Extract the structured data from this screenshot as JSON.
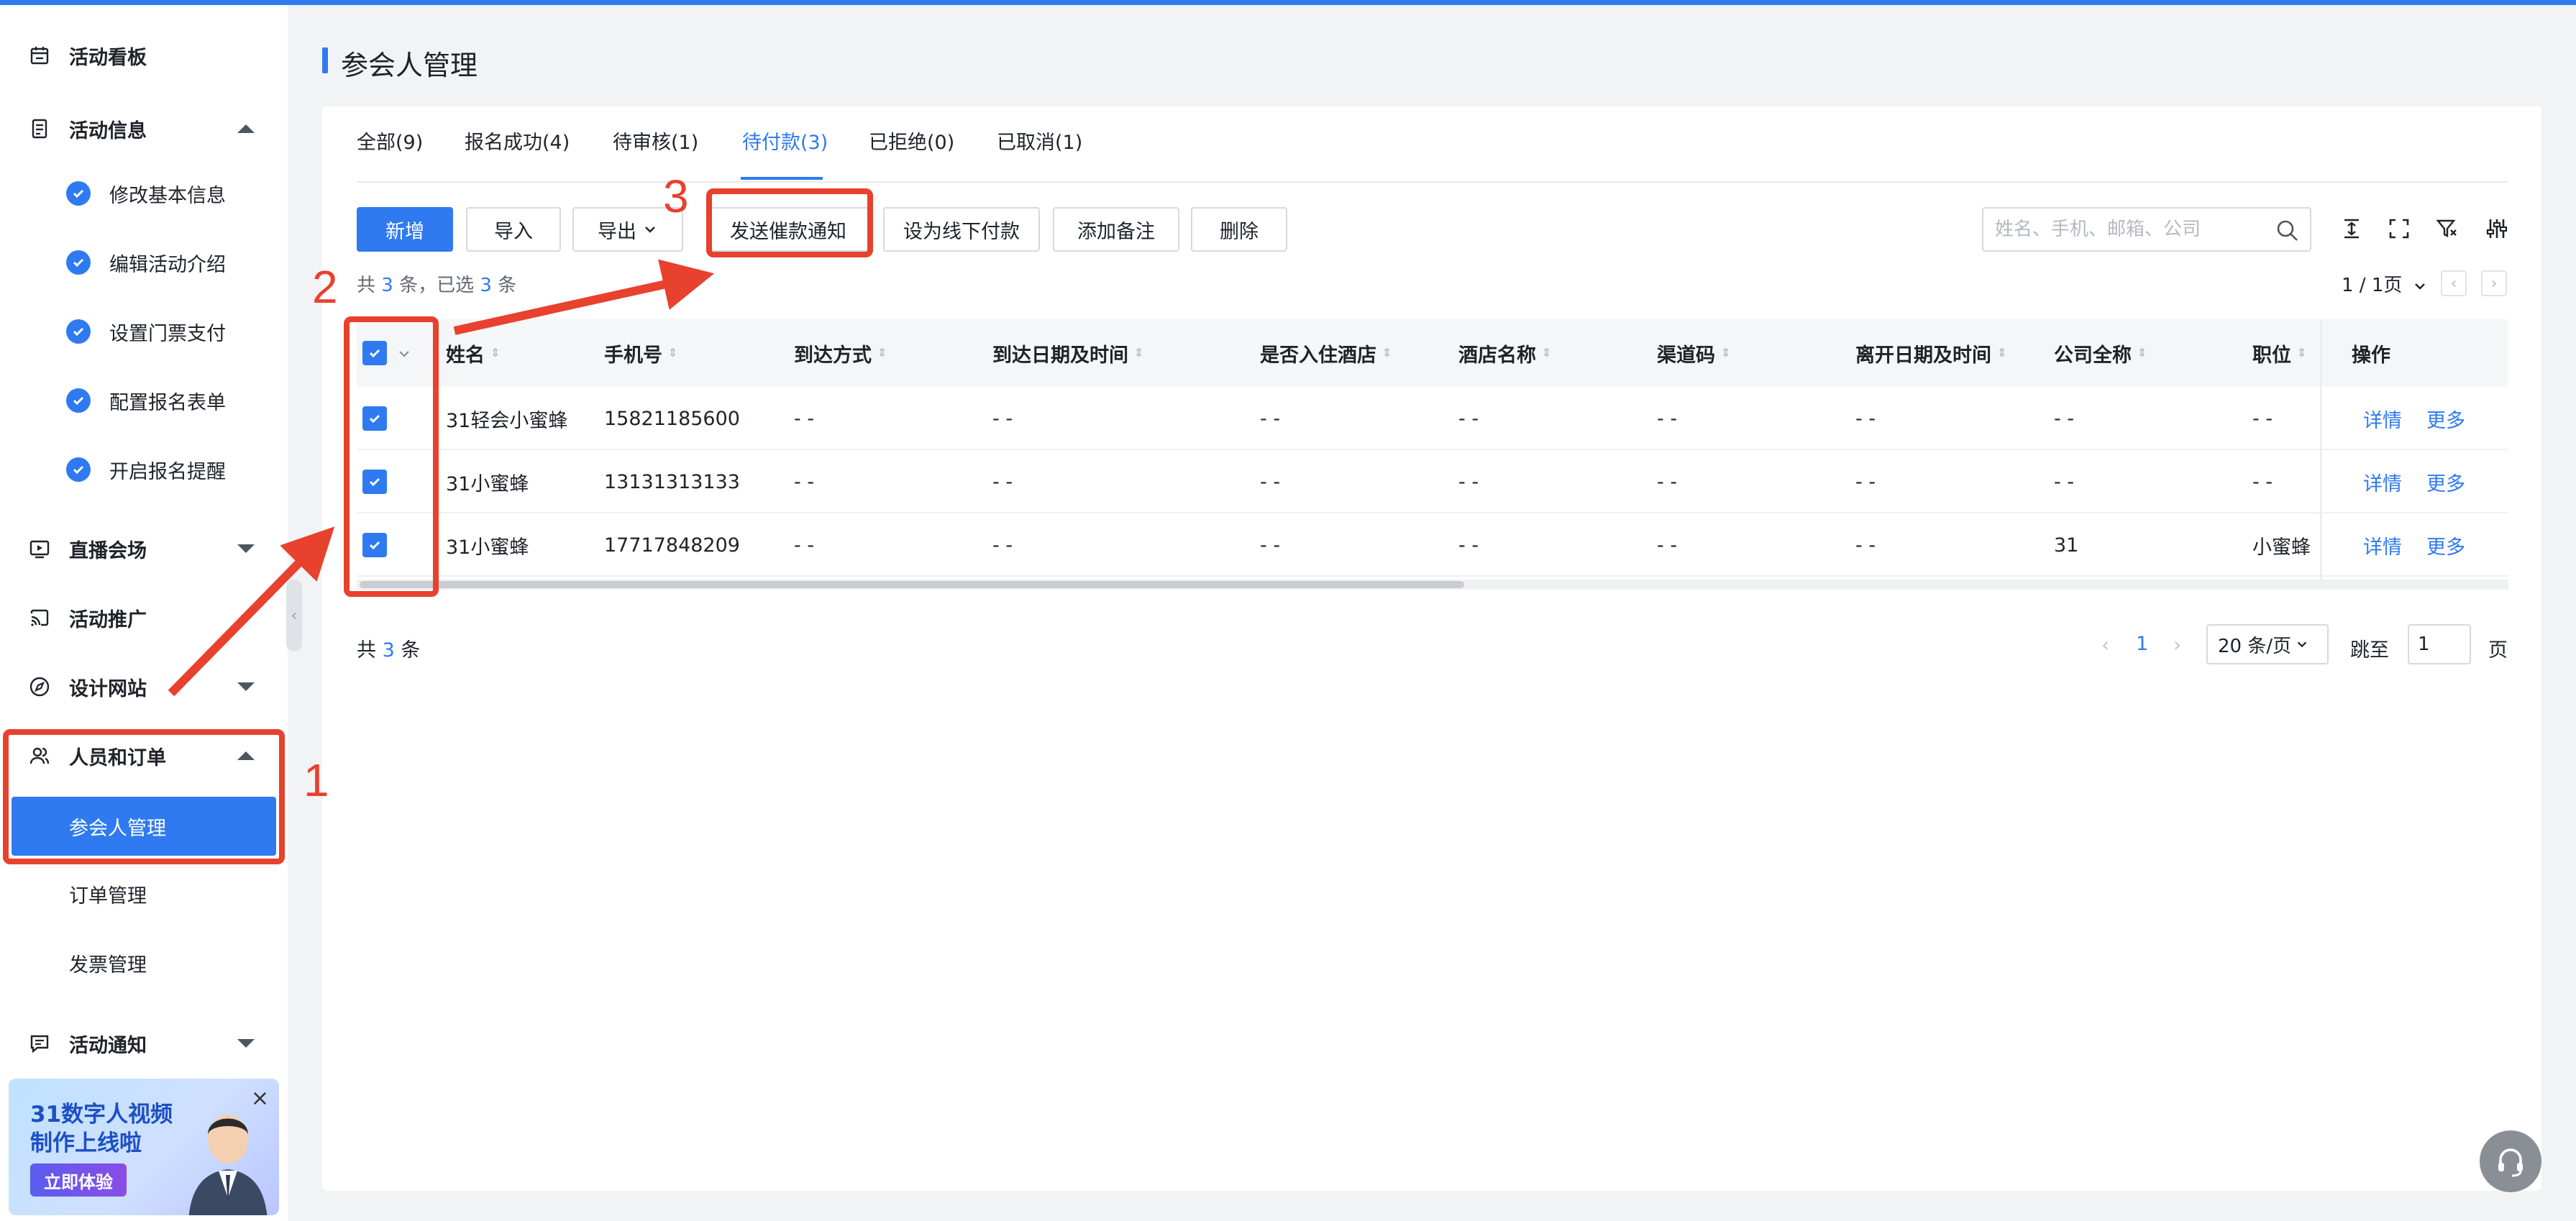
{
  "sidebar": {
    "items": [
      {
        "label": "活动看板",
        "icon": "calendar-icon"
      },
      {
        "label": "活动信息",
        "icon": "document-icon",
        "expanded": true,
        "children": [
          "修改基本信息",
          "编辑活动介绍",
          "设置门票支付",
          "配置报名表单",
          "开启报名提醒"
        ]
      },
      {
        "label": "直播会场",
        "icon": "live-icon",
        "expanded": false
      },
      {
        "label": "活动推广",
        "icon": "cast-icon"
      },
      {
        "label": "设计网站",
        "icon": "compass-icon",
        "expanded": false
      },
      {
        "label": "人员和订单",
        "icon": "users-icon",
        "expanded": true,
        "children": [
          "参会人管理",
          "订单管理",
          "发票管理"
        ],
        "active_child": "参会人管理"
      },
      {
        "label": "活动通知",
        "icon": "message-icon",
        "expanded": false
      }
    ],
    "promo": {
      "title": "31数字人视频制作上线啦",
      "button": "立即体验",
      "close": "×"
    }
  },
  "page": {
    "title": "参会人管理"
  },
  "tabs": [
    {
      "label": "全部(9)",
      "active": false
    },
    {
      "label": "报名成功(4)",
      "active": false
    },
    {
      "label": "待审核(1)",
      "active": false
    },
    {
      "label": "待付款(3)",
      "active": true
    },
    {
      "label": "已拒绝(0)",
      "active": false
    },
    {
      "label": "已取消(1)",
      "active": false
    }
  ],
  "toolbar": {
    "add": "新增",
    "import": "导入",
    "export": "导出",
    "send_reminder": "发送催款通知",
    "set_offline_payment": "设为线下付款",
    "add_note": "添加备注",
    "delete": "删除",
    "search_placeholder": "姓名、手机、邮箱、公司"
  },
  "summary": {
    "prefix": "共",
    "total": "3",
    "middle": "条，已选",
    "selected": "3",
    "suffix": "条"
  },
  "pager_top": {
    "text": "1 / 1页"
  },
  "table": {
    "columns": [
      "姓名",
      "手机号",
      "到达方式",
      "到达日期及时间",
      "是否入住酒店",
      "酒店名称",
      "渠道码",
      "离开日期及时间",
      "公司全称",
      "职位",
      "操作"
    ],
    "rows": [
      {
        "checked": true,
        "cells": [
          "31轻会小蜜蜂",
          "15821185600",
          "- -",
          "- -",
          "- -",
          "- -",
          "- -",
          "- -",
          "- -",
          "- -"
        ]
      },
      {
        "checked": true,
        "cells": [
          "31小蜜蜂",
          "13131313133",
          "- -",
          "- -",
          "- -",
          "- -",
          "- -",
          "- -",
          "- -",
          "- -"
        ]
      },
      {
        "checked": true,
        "cells": [
          "31小蜜蜂",
          "17717848209",
          "- -",
          "- -",
          "- -",
          "- -",
          "- -",
          "- -",
          "31",
          "小蜜蜂"
        ]
      }
    ],
    "actions": {
      "detail": "详情",
      "more": "更多"
    }
  },
  "pagination": {
    "total_prefix": "共",
    "total": "3",
    "total_suffix": "条",
    "current_page": "1",
    "page_size": "20 条/页",
    "jump_label": "跳至",
    "jump_value": "1",
    "page_unit": "页"
  },
  "annotations": {
    "step1": "1",
    "step2": "2",
    "step3": "3"
  },
  "colors": {
    "accent": "#2f7af0",
    "annotation": "#e8412e"
  }
}
